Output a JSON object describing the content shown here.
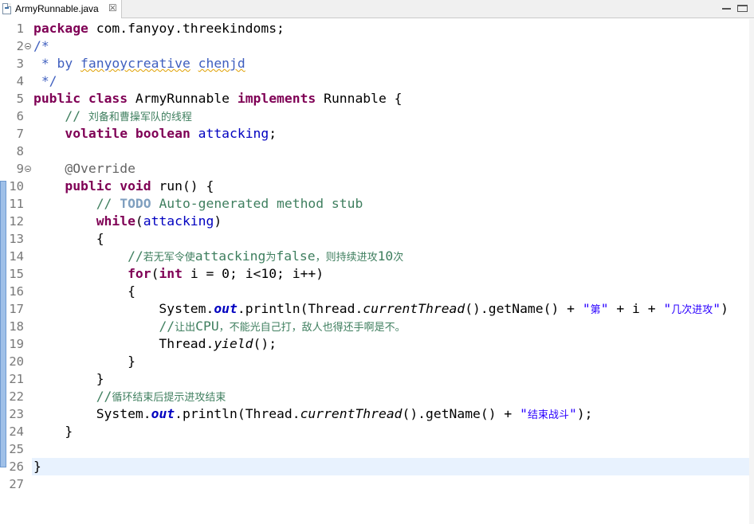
{
  "tab": {
    "title": "ArmyRunnable.java",
    "close": "☒"
  },
  "editor": {
    "current_line": 26,
    "lines": [
      {
        "n": "1",
        "t": [
          [
            "kw",
            "package"
          ],
          [
            "",
            " com.fanyoy.threekindoms;"
          ]
        ]
      },
      {
        "n": "2",
        "fold": true,
        "t": [
          [
            "jd",
            "/*"
          ]
        ]
      },
      {
        "n": "3",
        "t": [
          [
            "jd",
            " * by "
          ],
          [
            "jd-u",
            "fanyoycreative"
          ],
          [
            "jd",
            " "
          ],
          [
            "jd-u",
            "chenjd"
          ]
        ]
      },
      {
        "n": "4",
        "t": [
          [
            "jd",
            " */"
          ]
        ]
      },
      {
        "n": "5",
        "t": [
          [
            "kw",
            "public"
          ],
          [
            "",
            " "
          ],
          [
            "kw",
            "class"
          ],
          [
            "",
            " ArmyRunnable "
          ],
          [
            "kw",
            "implements"
          ],
          [
            "",
            " Runnable {"
          ]
        ]
      },
      {
        "n": "6",
        "t": [
          [
            "",
            "    "
          ],
          [
            "cm",
            "// "
          ],
          [
            "cm cjk",
            "刘备和曹操军队的线程"
          ]
        ]
      },
      {
        "n": "7",
        "t": [
          [
            "",
            "    "
          ],
          [
            "kw",
            "volatile"
          ],
          [
            "",
            " "
          ],
          [
            "kw",
            "boolean"
          ],
          [
            "",
            " "
          ],
          [
            "fld",
            "attacking"
          ],
          [
            "",
            ";"
          ]
        ]
      },
      {
        "n": "8",
        "t": [
          [
            "",
            ""
          ]
        ]
      },
      {
        "n": "9",
        "fold": true,
        "t": [
          [
            "",
            "    "
          ],
          [
            "ann",
            "@Override"
          ]
        ]
      },
      {
        "n": "10",
        "t": [
          [
            "",
            "    "
          ],
          [
            "kw",
            "public"
          ],
          [
            "",
            " "
          ],
          [
            "kw",
            "void"
          ],
          [
            "",
            " run() {"
          ]
        ]
      },
      {
        "n": "11",
        "t": [
          [
            "",
            "        "
          ],
          [
            "cm",
            "// "
          ],
          [
            "todo",
            "TODO"
          ],
          [
            "cm",
            " Auto-generated method stub"
          ]
        ]
      },
      {
        "n": "12",
        "t": [
          [
            "",
            "        "
          ],
          [
            "kw",
            "while"
          ],
          [
            "",
            "("
          ],
          [
            "fld",
            "attacking"
          ],
          [
            "",
            ")"
          ]
        ]
      },
      {
        "n": "13",
        "t": [
          [
            "",
            "        {"
          ]
        ]
      },
      {
        "n": "14",
        "t": [
          [
            "",
            "            "
          ],
          [
            "cm",
            "//"
          ],
          [
            "cm cjk",
            "若无军令使"
          ],
          [
            "cm",
            "attacking"
          ],
          [
            "cm cjk",
            "为"
          ],
          [
            "cm",
            "false"
          ],
          [
            "cm cjk",
            "，则持续进攻"
          ],
          [
            "cm",
            "10"
          ],
          [
            "cm cjk",
            "次"
          ]
        ]
      },
      {
        "n": "15",
        "t": [
          [
            "",
            "            "
          ],
          [
            "kw",
            "for"
          ],
          [
            "",
            "("
          ],
          [
            "kw",
            "int"
          ],
          [
            "",
            " i = 0; i<10; i++)"
          ]
        ]
      },
      {
        "n": "16",
        "t": [
          [
            "",
            "            {"
          ]
        ]
      },
      {
        "n": "17",
        "t": [
          [
            "",
            "                System."
          ],
          [
            "sfld",
            "out"
          ],
          [
            "",
            ".println(Thread."
          ],
          [
            "smth",
            "currentThread"
          ],
          [
            "",
            "().getName() + "
          ],
          [
            "str",
            "\""
          ],
          [
            "str cjk",
            "第"
          ],
          [
            "str",
            "\""
          ],
          [
            "",
            " + i + "
          ],
          [
            "str",
            "\""
          ],
          [
            "str cjk",
            "几次进攻"
          ],
          [
            "str",
            "\""
          ],
          [
            "",
            ")"
          ]
        ]
      },
      {
        "n": "18",
        "t": [
          [
            "",
            "                "
          ],
          [
            "cm",
            "//"
          ],
          [
            "cm cjk",
            "让出"
          ],
          [
            "cm",
            "CPU"
          ],
          [
            "cm cjk",
            "，不能光自己打，敌人也得还手啊是不。"
          ]
        ]
      },
      {
        "n": "19",
        "t": [
          [
            "",
            "                Thread."
          ],
          [
            "smth",
            "yield"
          ],
          [
            "",
            "();"
          ]
        ]
      },
      {
        "n": "20",
        "t": [
          [
            "",
            "            }"
          ]
        ]
      },
      {
        "n": "21",
        "t": [
          [
            "",
            "        }"
          ]
        ]
      },
      {
        "n": "22",
        "t": [
          [
            "",
            "        "
          ],
          [
            "cm",
            "//"
          ],
          [
            "cm cjk",
            "循环结束后提示进攻结束"
          ]
        ]
      },
      {
        "n": "23",
        "t": [
          [
            "",
            "        System."
          ],
          [
            "sfld",
            "out"
          ],
          [
            "",
            ".println(Thread."
          ],
          [
            "smth",
            "currentThread"
          ],
          [
            "",
            "().getName() + "
          ],
          [
            "str",
            "\""
          ],
          [
            "str cjk",
            "结束战斗"
          ],
          [
            "str",
            "\""
          ],
          [
            "",
            ");"
          ]
        ]
      },
      {
        "n": "24",
        "t": [
          [
            "",
            "    }"
          ]
        ]
      },
      {
        "n": "25",
        "t": [
          [
            "",
            ""
          ]
        ]
      },
      {
        "n": "26",
        "t": [
          [
            "",
            "}"
          ]
        ]
      },
      {
        "n": "27",
        "t": [
          [
            "",
            ""
          ]
        ]
      }
    ]
  }
}
